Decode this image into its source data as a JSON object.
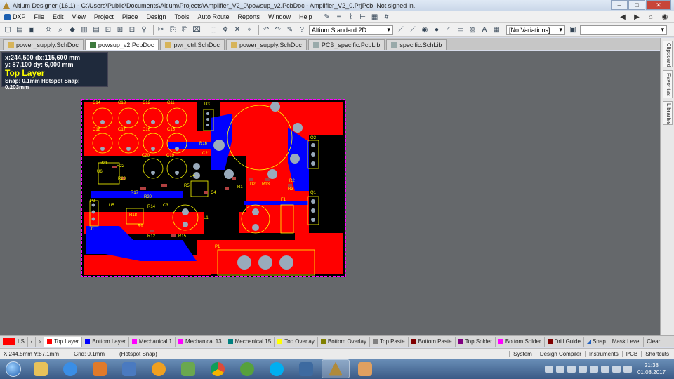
{
  "window": {
    "title": "Altium Designer (16.1) - C:\\Users\\Public\\Documents\\Altium\\Projects\\Amplifier_V2_0\\powsup_v2.PcbDoc - Amplifier_V2_0.PrjPcb. Not signed in.",
    "controls": [
      "–",
      "□",
      "✕"
    ]
  },
  "menu": [
    "DXP",
    "File",
    "Edit",
    "View",
    "Project",
    "Place",
    "Design",
    "Tools",
    "Auto Route",
    "Reports",
    "Window",
    "Help"
  ],
  "toolbar": {
    "view_combo": "Altium Standard 2D",
    "variations_combo": "[No Variations]"
  },
  "doc_tabs": [
    {
      "label": "power_supply.SchDoc",
      "kind": "sch"
    },
    {
      "label": "powsup_v2.PcbDoc",
      "kind": "pcb",
      "active": true
    },
    {
      "label": "pwr_ctrl.SchDoc",
      "kind": "sch"
    },
    {
      "label": "power_supply.SchDoc",
      "kind": "sch"
    },
    {
      "label": "PCB_specific.PcbLib",
      "kind": "lib"
    },
    {
      "label": "specific.SchLib",
      "kind": "lib"
    }
  ],
  "coord_panel": {
    "line1": "x:244,500  dx:115,600 mm",
    "line2": "y: 87,100   dy:  6,000  mm",
    "layer": "Top Layer",
    "snap": "Snap: 0.1mm Hotspot Snap: 0.203mm"
  },
  "side_panels": [
    "Clipboard",
    "Favorites",
    "Libraries"
  ],
  "pcb": {
    "labels": {
      "c14": "C14",
      "c13": "C13",
      "c12": "C12",
      "c11": "C11",
      "c18": "C18",
      "c17": "C17",
      "c16": "C16",
      "c15": "C15",
      "c20": "C20",
      "c19": "C19",
      "d3": "D3",
      "r16": "R16",
      "r21": "R21",
      "r22": "R22",
      "u6": "U6",
      "r23": "R23",
      "d2": "D2",
      "r13": "R13",
      "r1": "R1",
      "r2": "R2",
      "q1": "Q1",
      "r3": "R3",
      "r5": "R5",
      "p3": "P3",
      "u5": "U5",
      "r17": "R17",
      "r20": "R20",
      "r14": "R14",
      "r12": "R12",
      "c3": "C3",
      "r15": "R15",
      "j1": "J1",
      "r9": "R9",
      "r18": "R18",
      "l1": "L1",
      "f1": "F1",
      "p1": "P1",
      "c4": "C4",
      "u4": "U4",
      "q2": "Q2",
      "c21": "C21"
    }
  },
  "layers": [
    {
      "label": "Top Layer",
      "color": "#ff0000",
      "active": true
    },
    {
      "label": "Bottom Layer",
      "color": "#0000ff"
    },
    {
      "label": "Mechanical 1",
      "color": "#ff00ff"
    },
    {
      "label": "Mechanical 13",
      "color": "#ff00ff"
    },
    {
      "label": "Mechanical 15",
      "color": "#008080"
    },
    {
      "label": "Top Overlay",
      "color": "#ffff00"
    },
    {
      "label": "Bottom Overlay",
      "color": "#808000"
    },
    {
      "label": "Top Paste",
      "color": "#808080"
    },
    {
      "label": "Bottom Paste",
      "color": "#800000"
    },
    {
      "label": "Top Solder",
      "color": "#800080"
    },
    {
      "label": "Bottom Solder",
      "color": "#ff00ff"
    },
    {
      "label": "Drill Guide",
      "color": "#800000"
    }
  ],
  "layer_controls": {
    "snap": "Snap",
    "mask": "Mask Level",
    "clear": "Clear",
    "ls": "LS"
  },
  "status": {
    "coords": "X:244.5mm Y:87.1mm",
    "grid": "Grid: 0.1mm",
    "snap": "(Hotspot Snap)",
    "panels": [
      "System",
      "Design Compiler",
      "Instruments",
      "PCB",
      "Shortcuts"
    ]
  },
  "taskbar": {
    "time": "21:38",
    "date": "01.08.2017",
    "apps": [
      {
        "name": "explorer",
        "color": "#e8c25a"
      },
      {
        "name": "ie",
        "color": "#3a8ee6"
      },
      {
        "name": "media",
        "color": "#e07a2a"
      },
      {
        "name": "sound",
        "color": "#4a7ac0"
      },
      {
        "name": "mail",
        "color": "#f0a020"
      },
      {
        "name": "apps",
        "color": "#6aa84f"
      },
      {
        "name": "chrome",
        "color": "#dd4b39"
      },
      {
        "name": "torrent",
        "color": "#56a13c"
      },
      {
        "name": "skype",
        "color": "#00aff0"
      },
      {
        "name": "viewer",
        "color": "#3d6aa0"
      },
      {
        "name": "altium",
        "color": "#b08a3a",
        "active": true
      },
      {
        "name": "paint",
        "color": "#e0a060"
      }
    ]
  }
}
